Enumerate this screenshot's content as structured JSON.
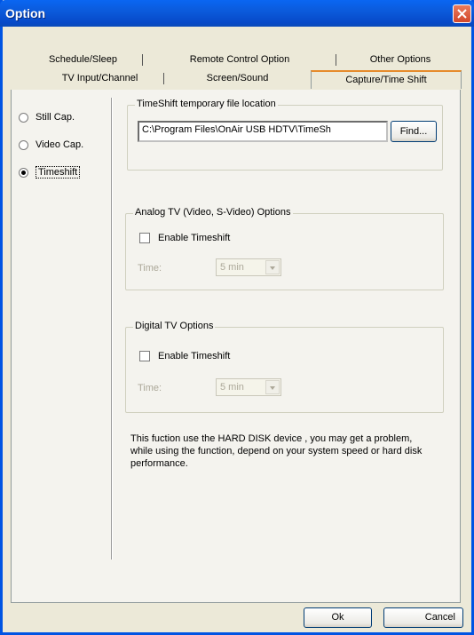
{
  "window": {
    "title": "Option"
  },
  "tabs": {
    "row1": [
      "Schedule/Sleep",
      "Remote Control Option",
      "Other Options"
    ],
    "row2": [
      "TV Input/Channel",
      "Screen/Sound",
      "Capture/Time Shift"
    ],
    "active": "Capture/Time Shift"
  },
  "left_options": {
    "items": [
      "Still Cap.",
      "Video Cap.",
      "Timeshift"
    ],
    "selected": "Timeshift"
  },
  "timeshift_location": {
    "legend": "TimeShift temporary file location",
    "path_value": "C:\\Program Files\\OnAir USB HDTV\\TimeSh",
    "find_label": "Find..."
  },
  "analog": {
    "legend": "Analog TV (Video, S-Video) Options",
    "enable_label": "Enable Timeshift",
    "time_label": "Time:",
    "time_value": "5 min"
  },
  "digital": {
    "legend": "Digital TV Options",
    "enable_label": "Enable Timeshift",
    "time_label": "Time:",
    "time_value": "5 min"
  },
  "note": "This fuction use the HARD DISK device , you  may get a problem, while using the function,  depend on your system speed or hard disk performance.",
  "footer": {
    "ok": "Ok",
    "cancel": "Cancel"
  }
}
